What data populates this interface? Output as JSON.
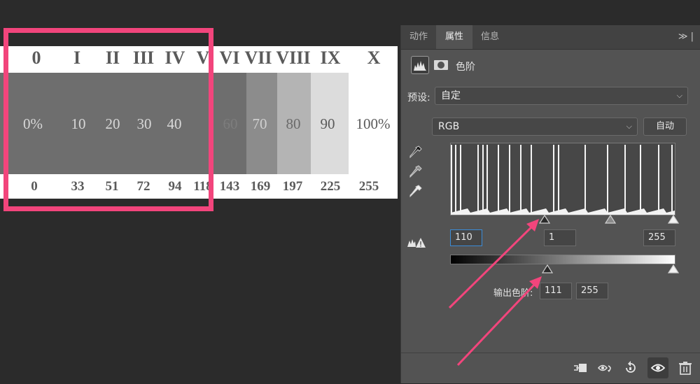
{
  "zone_chart": {
    "numerals": [
      "0",
      "I",
      "II",
      "III",
      "IV",
      "V",
      "VI",
      "VII",
      "VIII",
      "IX",
      "X"
    ],
    "percent_labels": [
      "0%",
      "10",
      "20",
      "30",
      "40",
      "",
      "60",
      "70",
      "80",
      "90",
      "100%"
    ],
    "bottom_values": [
      "0",
      "33",
      "51",
      "72",
      "94",
      "118",
      "143",
      "169",
      "197",
      "225",
      "255"
    ],
    "swatch_colors": [
      "#6e6e6e",
      "#6e6e6e",
      "#6e6e6e",
      "#6e6e6e",
      "#6e6e6e",
      "#6e6e6e",
      "#6e6e6e",
      "#8c8c8c",
      "#b4b4b4",
      "#dcdcdc",
      "#ffffff"
    ],
    "label_colors": [
      "#d8d8d8",
      "#d8d8d8",
      "#d8d8d8",
      "#d8d8d8",
      "#d8d8d8",
      "#d8d8d8",
      "#7d7d7d",
      "#d0d0d0",
      "#6a6a6a",
      "#5a5a5a",
      "#5a5a5a"
    ]
  },
  "highlight_color": "#f2457c",
  "panel": {
    "tabs": [
      {
        "label": "动作",
        "active": false
      },
      {
        "label": "属性",
        "active": true
      },
      {
        "label": "信息",
        "active": false
      }
    ],
    "tab_more": "≫ |",
    "header_title": "色阶",
    "preset_label": "预设:",
    "preset_value": "自定",
    "channel_value": "RGB",
    "auto_button": "自动",
    "input_black": "110",
    "input_gamma": "1",
    "input_white": "255",
    "output_label": "输出色阶:",
    "output_black": "111",
    "output_white": "255"
  },
  "histogram": {
    "spikes": [
      0.0,
      0.02,
      0.04,
      0.12,
      0.14,
      0.16,
      0.21,
      0.26,
      0.31,
      0.36,
      0.46,
      0.48,
      0.6,
      0.7,
      0.78,
      0.85,
      0.93,
      0.99
    ]
  }
}
